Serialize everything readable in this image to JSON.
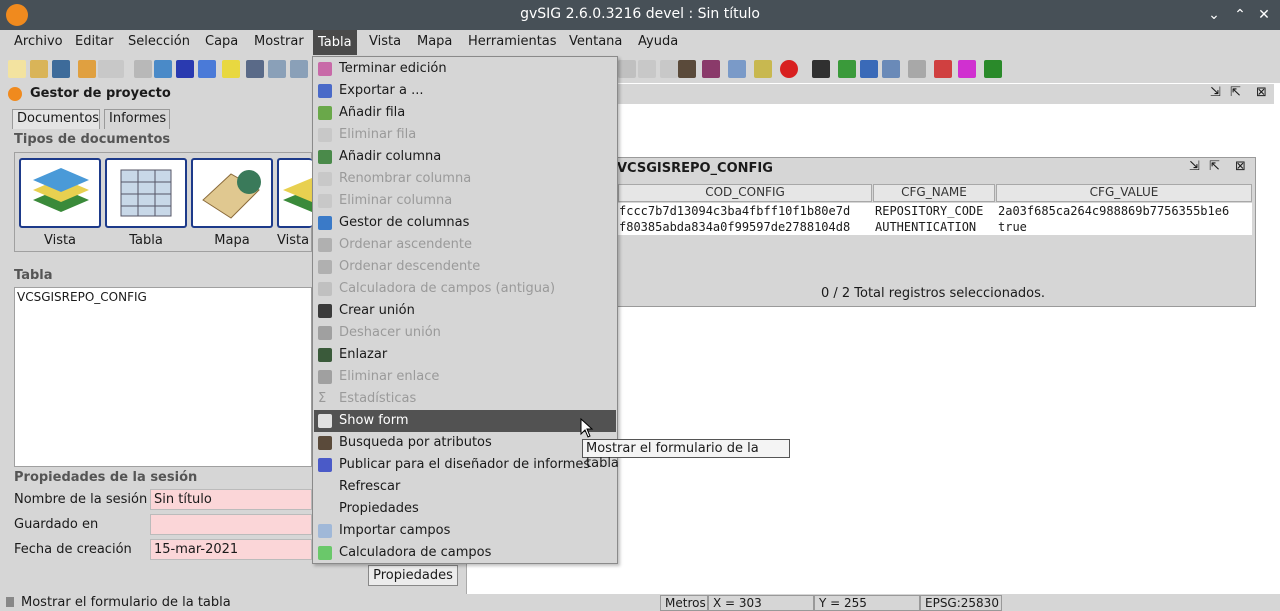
{
  "window": {
    "title": "gvSIG 2.6.0.3216 devel : Sin título"
  },
  "menubar": [
    "Archivo",
    "Editar",
    "Selección",
    "Capa",
    "Mostrar",
    "Tabla",
    "Vista",
    "Mapa",
    "Herramientas",
    "Ventana",
    "Ayuda"
  ],
  "project": {
    "title": "Gestor de proyecto",
    "tabs": [
      "Documentos",
      "Informes"
    ],
    "doc_types_label": "Tipos de documentos",
    "doc_types": [
      "Vista",
      "Tabla",
      "Mapa",
      "Vista"
    ],
    "table_label": "Tabla",
    "tables": [
      "VCSGISREPO_CONFIG"
    ],
    "session_label": "Propiedades de la sesión",
    "session_name_label": "Nombre de la sesión",
    "session_name": "Sin título",
    "saved_label": "Guardado en",
    "saved_value": "",
    "created_label": "Fecha de creación",
    "created_value": "15-mar-2021",
    "properties_button": "Propiedades"
  },
  "tabla_menu": [
    {
      "label": "Terminar edición",
      "enabled": true
    },
    {
      "label": "Exportar a ...",
      "enabled": true
    },
    {
      "label": "Añadir fila",
      "enabled": true
    },
    {
      "label": "Eliminar fila",
      "enabled": false
    },
    {
      "label": "Añadir columna",
      "enabled": true
    },
    {
      "label": "Renombrar columna",
      "enabled": false
    },
    {
      "label": "Eliminar columna",
      "enabled": false
    },
    {
      "label": "Gestor de columnas",
      "enabled": true
    },
    {
      "label": "Ordenar ascendente",
      "enabled": false
    },
    {
      "label": "Ordenar descendente",
      "enabled": false
    },
    {
      "label": "Calculadora de campos (antigua)",
      "enabled": false
    },
    {
      "label": "Crear unión",
      "enabled": true
    },
    {
      "label": "Deshacer unión",
      "enabled": false
    },
    {
      "label": "Enlazar",
      "enabled": true
    },
    {
      "label": "Eliminar enlace",
      "enabled": false
    },
    {
      "label": "Estadísticas",
      "enabled": false
    },
    {
      "label": "Show form",
      "enabled": true,
      "highlighted": true
    },
    {
      "label": "Busqueda por atributos",
      "enabled": true
    },
    {
      "label": "Publicar para el diseñador de informes",
      "enabled": true
    },
    {
      "label": "Refrescar",
      "enabled": true
    },
    {
      "label": "Propiedades",
      "enabled": true
    },
    {
      "label": "Importar campos",
      "enabled": true
    },
    {
      "label": "Calculadora de campos",
      "enabled": true
    }
  ],
  "tooltip": "Mostrar el formulario de la tabla",
  "table_window": {
    "title": "VCSGISREPO_CONFIG",
    "columns": [
      "COD_CONFIG",
      "CFG_NAME",
      "CFG_VALUE"
    ],
    "rows": [
      [
        "fccc7b7d13094c3ba4fbff10f1b80e7d",
        "REPOSITORY_CODE",
        "2a03f685ca264c988869b7756355b1e6"
      ],
      [
        "f80385abda834a0f99597de2788104d8",
        "AUTHENTICATION",
        "true"
      ]
    ],
    "footer": "0 / 2 Total registros seleccionados."
  },
  "statusbar": {
    "message": "Mostrar el formulario de la tabla",
    "units": "Metros",
    "x": "X = 303",
    "y": "Y = 255",
    "crs": "EPSG:25830"
  },
  "colors": {
    "titlebar": "#475057",
    "menu_highlight": "#525252",
    "field_bg": "#fbd6d8",
    "accent": "#1d3a8a"
  }
}
